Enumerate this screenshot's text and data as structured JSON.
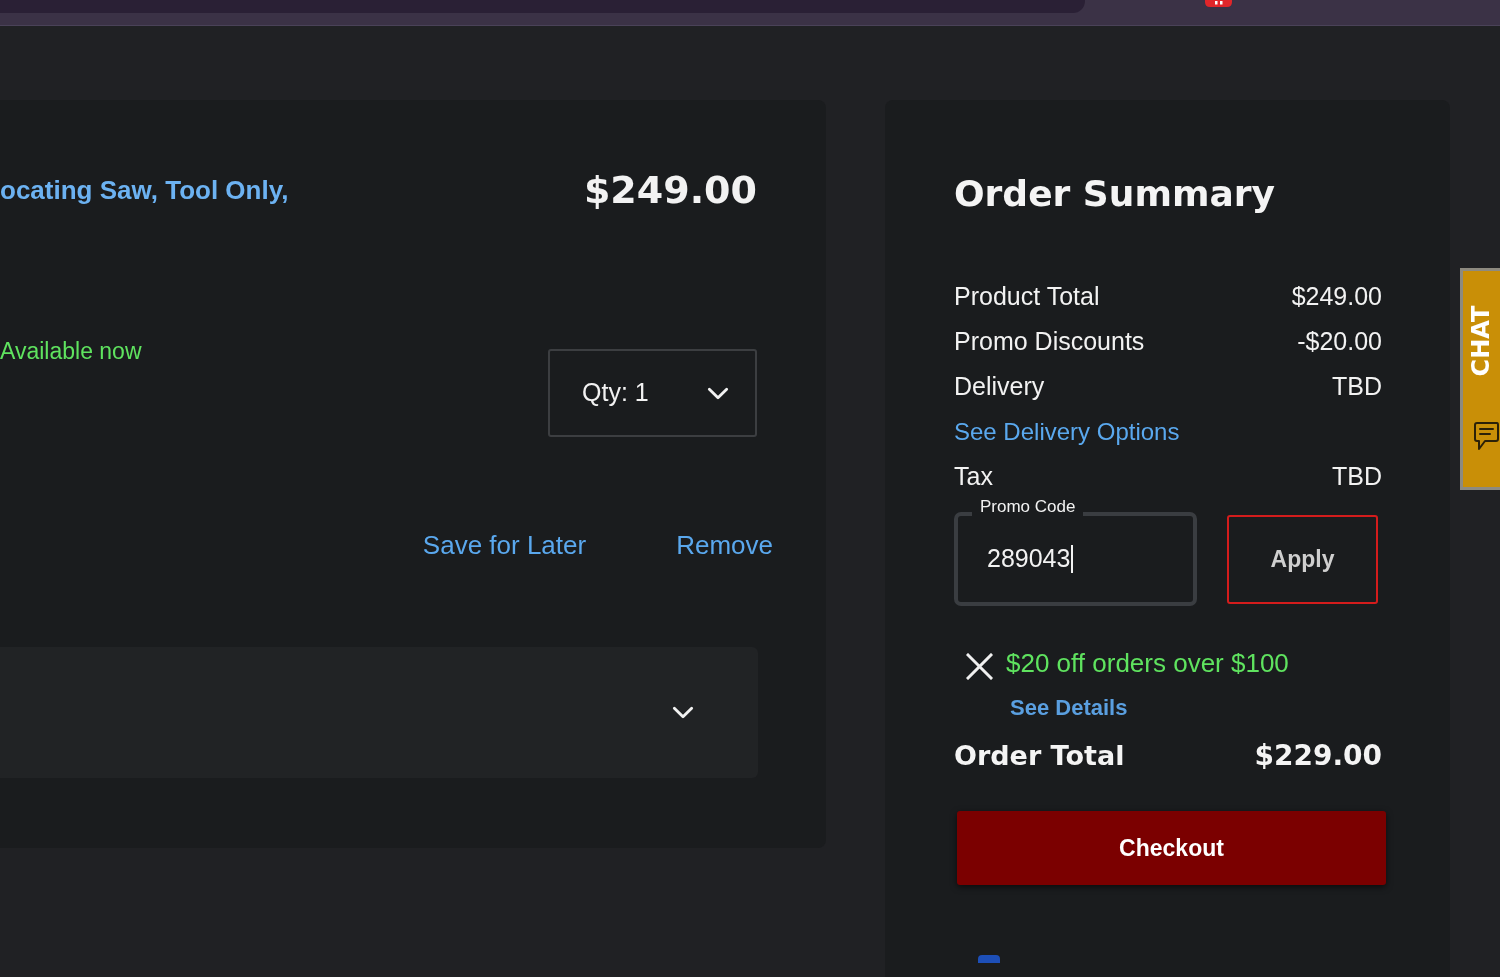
{
  "cart_item": {
    "title": "ocating Saw, Tool Only,",
    "price": "$249.00",
    "availability": "Available now",
    "quantity": {
      "label": "Qty: 1"
    },
    "actions": [
      "Save for Later",
      "Remove"
    ],
    "details_panel": {
      "expanded": false
    }
  },
  "order_summary": {
    "title": "Order Summary",
    "lines": [
      {
        "kind": "amount",
        "label": "Product Total",
        "value": "$249.00"
      },
      {
        "kind": "amount",
        "label": "Promo Discounts",
        "value": "-$20.00"
      },
      {
        "kind": "amount",
        "label": "Delivery",
        "value": "TBD"
      },
      {
        "kind": "link",
        "label": "See Delivery Options"
      },
      {
        "kind": "amount",
        "label": "Tax",
        "value": "TBD"
      }
    ],
    "promo_code": {
      "label": "Promo Code",
      "value": "289043",
      "focused": true
    },
    "apply_button": "Apply",
    "applied_promo": {
      "text": "$20 off orders over $100",
      "details_link": "See Details"
    },
    "order_total": {
      "label": "Order Total",
      "value": "$229.00"
    },
    "checkout_button": "Checkout"
  },
  "chat_tab": {
    "label": "CHAT"
  }
}
